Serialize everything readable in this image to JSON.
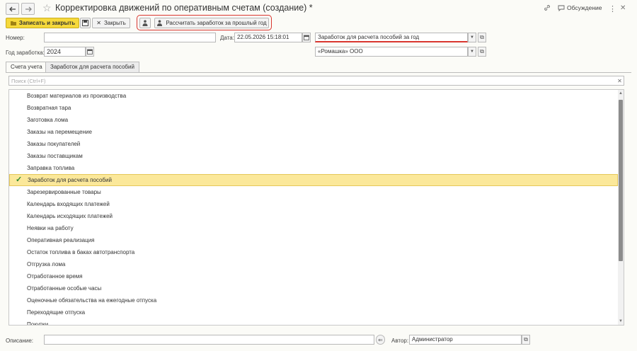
{
  "header": {
    "title": "Корректировка движений по оперативным счетам (создание) *",
    "discussion_label": "Обсуждение"
  },
  "toolbar": {
    "save_close_label": "Записать и закрыть",
    "close_label": "Закрыть",
    "calc_label": "Рассчитать заработок за прошлый год"
  },
  "form": {
    "number_label": "Номер:",
    "number_value": "",
    "date_label": "Дата:",
    "date_value": "22.05.2026 15:18:01",
    "register_value": "Заработок для расчета пособий за год",
    "year_label": "Год заработка:",
    "year_value": "2024",
    "org_value": "«Ромашка» ООО"
  },
  "tabs": [
    {
      "label": "Счета учета"
    },
    {
      "label": "Заработок для расчета пособий"
    }
  ],
  "search": {
    "placeholder": "Поиск (Ctrl+F)"
  },
  "list": {
    "items": [
      "Возврат материалов из производства",
      "Возвратная тара",
      "Заготовка лома",
      "Заказы на перемещение",
      "Заказы покупателей",
      "Заказы поставщикам",
      "Заправка топлива",
      "Заработок для расчета пособий",
      "Зарезервированные товары",
      "Календарь входящих платежей",
      "Календарь исходящих платежей",
      "Неявки на работу",
      "Оперативная реализация",
      "Остаток топлива в баках автотранспорта",
      "Отгрузка лома",
      "Отработанное время",
      "Отработанные особые часы",
      "Оценочные обязательства на ежегодные отпуска",
      "Переходящие отпуска",
      "Покупки"
    ],
    "selected_index": 7
  },
  "footer": {
    "description_label": "Описание:",
    "description_value": "",
    "author_label": "Автор:",
    "author_value": "Администратор"
  },
  "colors": {
    "primary_button": "#f6d93b",
    "selected_row": "#fbe89a",
    "highlight_border": "#d9362f",
    "check": "#2f8a2f"
  }
}
